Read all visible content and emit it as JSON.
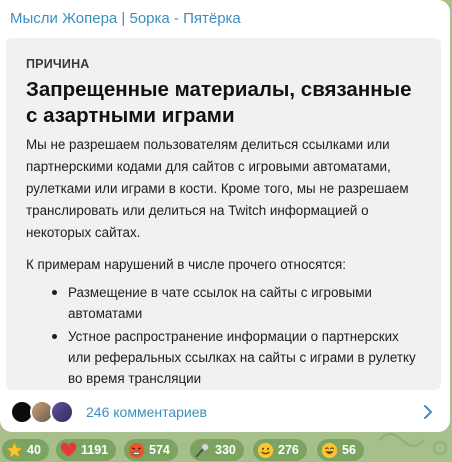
{
  "header": {
    "channel_title": "Мысли Жопера | 5орка - Пятёрка"
  },
  "card": {
    "label": "ПРИЧИНА",
    "heading": "Запрещенные материалы, связанные с азартными играми",
    "paragraph": "Мы не разрешаем пользователям делиться ссылками или партнерскими кодами для сайтов с игровыми автоматами, рулетками или играми в кости. Кроме того, мы не разрешаем транслировать или делиться на Twitch информацией о некоторых сайтах.",
    "paragraph2": "К примерам нарушений в числе прочего относятся:",
    "bullets": [
      "Размещение в чате ссылок на сайты с игровыми автоматами",
      "Устное распространение информации о партнерских или реферальных ссылках на сайты с играми в рулетку во время трансляции"
    ]
  },
  "comments": {
    "label": "246 комментариев"
  },
  "reactions": [
    {
      "icon": "star-icon",
      "count": "40"
    },
    {
      "icon": "heart-icon",
      "count": "1191"
    },
    {
      "icon": "angry-face-icon",
      "count": "574"
    },
    {
      "icon": "microphone-icon",
      "count": "330"
    },
    {
      "icon": "grin-face-icon",
      "count": "276"
    },
    {
      "icon": "laughing-face-icon",
      "count": "56"
    }
  ],
  "colors": {
    "accent": "#3a8fbf",
    "background": "#a7c08b",
    "pill": "#7da360"
  }
}
